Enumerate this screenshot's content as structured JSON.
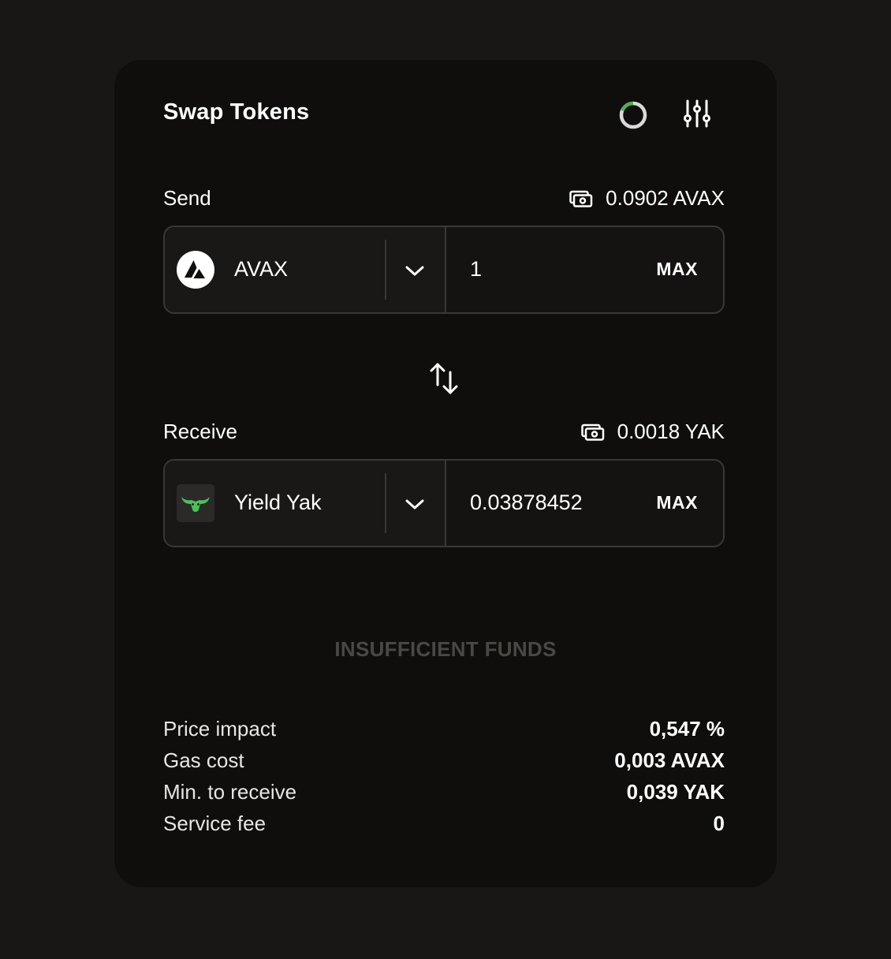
{
  "header": {
    "title": "Swap Tokens",
    "refresh_icon": "refresh-progress-icon",
    "settings_icon": "sliders-icon"
  },
  "send": {
    "label": "Send",
    "balance_icon": "wallet-icon",
    "balance": "0.0902 AVAX",
    "token_icon": "avax-logo",
    "token_name": "AVAX",
    "amount": "1",
    "max_label": "MAX"
  },
  "swap_icon": "swap-arrows-icon",
  "receive": {
    "label": "Receive",
    "balance_icon": "wallet-icon",
    "balance": "0.0018 YAK",
    "token_icon": "yield-yak-logo",
    "token_name": "Yield Yak",
    "amount": "0.03878452",
    "max_label": "MAX"
  },
  "action": {
    "label": "INSUFFICIENT FUNDS"
  },
  "details": [
    {
      "label": "Price impact",
      "value": "0,547 %"
    },
    {
      "label": "Gas cost",
      "value": "0,003 AVAX"
    },
    {
      "label": "Min. to receive",
      "value": "0,039 YAK"
    },
    {
      "label": "Service fee",
      "value": "0"
    }
  ],
  "colors": {
    "background": "#191716",
    "card": "#0f0e0d",
    "accent_green": "#4caf50",
    "muted_text": "#4a4744",
    "border": "#3a3836"
  }
}
